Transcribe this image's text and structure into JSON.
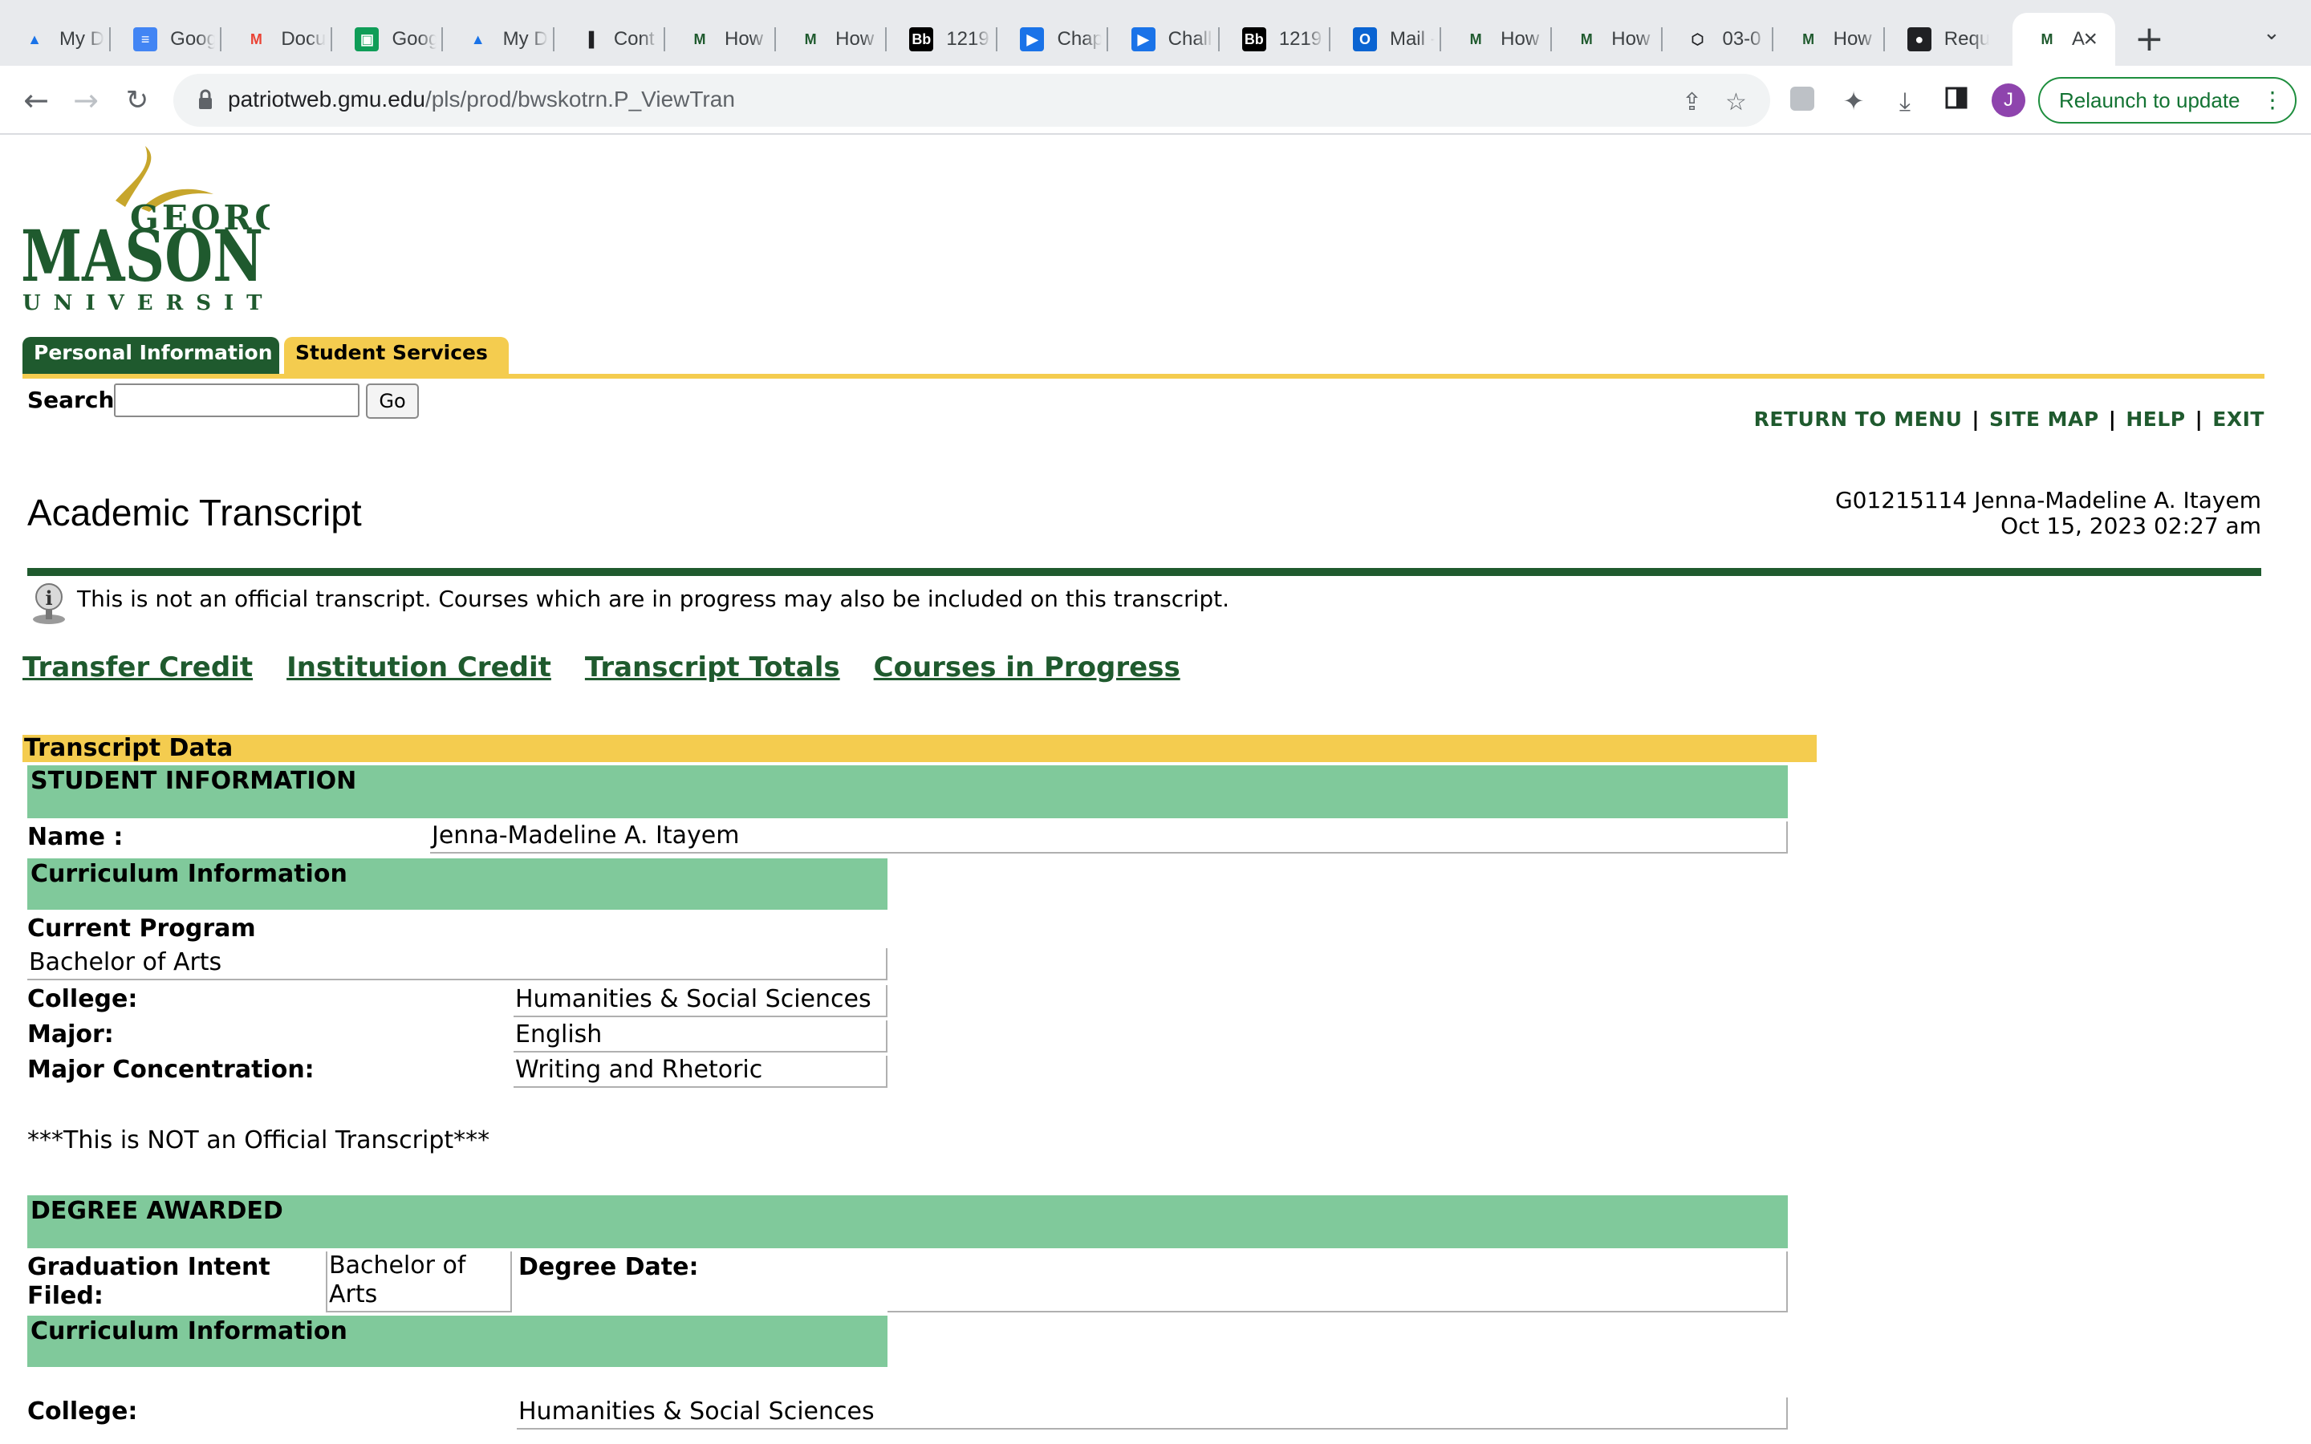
{
  "browser": {
    "tabs": [
      {
        "label": "My D",
        "icon": "google-drive-icon"
      },
      {
        "label": "Goog",
        "icon": "google-docs-icon"
      },
      {
        "label": "Docu",
        "icon": "gmail-icon"
      },
      {
        "label": "Goog",
        "icon": "google-classroom-icon"
      },
      {
        "label": "My D",
        "icon": "google-drive-icon"
      },
      {
        "label": "Cont",
        "icon": "bar-chart-icon"
      },
      {
        "label": "How",
        "icon": "gmu-icon"
      },
      {
        "label": "How",
        "icon": "gmu-icon"
      },
      {
        "label": "1219",
        "icon": "blackboard-icon"
      },
      {
        "label": "Chap",
        "icon": "video-icon"
      },
      {
        "label": "Chall",
        "icon": "video-icon"
      },
      {
        "label": "1219",
        "icon": "blackboard-icon"
      },
      {
        "label": "Mail -",
        "icon": "outlook-icon"
      },
      {
        "label": "How",
        "icon": "gmu-icon"
      },
      {
        "label": "How",
        "icon": "gmu-icon"
      },
      {
        "label": "03-0",
        "icon": "codepen-icon"
      },
      {
        "label": "How",
        "icon": "gmu-icon"
      },
      {
        "label": "Requ",
        "icon": "github-icon"
      },
      {
        "label": "A",
        "icon": "gmu-icon"
      }
    ],
    "new_tab": "+",
    "url_host": "patriotweb.gmu.edu",
    "url_path": "/pls/prod/bwskotrn.P_ViewTran",
    "avatar_letter": "J",
    "relaunch_label": "Relaunch to update"
  },
  "site": {
    "logo": {
      "top": "GEORGE",
      "main": "MASON",
      "bottom": "UNIVERSITY"
    },
    "tabs": [
      "Personal Information",
      "Student Services"
    ],
    "search_label": "Search",
    "search_placeholder": "",
    "go_label": "Go",
    "links": [
      "RETURN TO MENU",
      "SITE MAP",
      "HELP",
      "EXIT"
    ],
    "link_sep": "|"
  },
  "page": {
    "title": "Academic Transcript",
    "student_id_line": "G01215114 Jenna-Madeline A. Itayem",
    "timestamp": "Oct 15, 2023 02:27 am",
    "notice": "This is not an official transcript. Courses which are in progress may also be included on this transcript.",
    "anchors": [
      "Transfer Credit",
      "Institution Credit",
      "Transcript Totals",
      "Courses in Progress"
    ]
  },
  "transcript": {
    "header": "Transcript Data",
    "student_info_header": "STUDENT INFORMATION",
    "name_label": "Name :",
    "name_value": "Jenna-Madeline A. Itayem",
    "curriculum_header": "Curriculum Information",
    "current_program_label": "Current Program",
    "current_program_value": "Bachelor of Arts",
    "college_label": "College:",
    "college_value": "Humanities & Social Sciences",
    "major_label": "Major:",
    "major_value": "English",
    "concentration_label": "Major Concentration:",
    "concentration_value": "Writing and Rhetoric",
    "not_official": "***This is NOT an Official Transcript***",
    "degree_header": "DEGREE AWARDED",
    "grad_intent_label": "Graduation Intent Filed:",
    "grad_intent_value": "Bachelor of Arts",
    "degree_date_label": "Degree Date:",
    "degree_date_value": "",
    "curriculum_header_2": "Curriculum Information",
    "college_label_2": "College:",
    "college_value_2": "Humanities & Social Sciences"
  },
  "colors": {
    "gmu_green": "#1f5a2e",
    "gmu_gold": "#f4cc4f",
    "section_green": "#80c99b"
  }
}
